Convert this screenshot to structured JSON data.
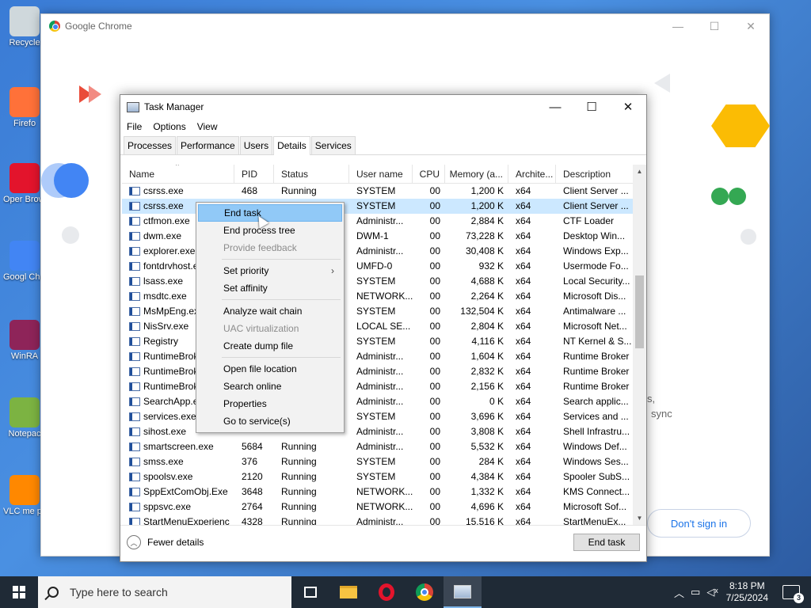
{
  "desktop": {
    "icons": [
      {
        "label": "Recycle",
        "color": "#cfd8dc"
      },
      {
        "label": "Firefo",
        "color": "#ff7139"
      },
      {
        "label": "Oper Brows",
        "color": "#e3142c"
      },
      {
        "label": "Googl Chron",
        "color": "#4285f4"
      },
      {
        "label": "WinRA",
        "color": "#8e2459"
      },
      {
        "label": "Notepac",
        "color": "#7cb342"
      },
      {
        "label": "VLC me playe",
        "color": "#ff8800"
      }
    ]
  },
  "chrome": {
    "title": "Google Chrome",
    "controls": {
      "minimize": "—",
      "maximize": "☐",
      "close": "✕"
    },
    "side_text_1": "s,",
    "side_text_2": "sync",
    "dont_sign_in": "Don't sign in"
  },
  "task_manager": {
    "title": "Task Manager",
    "controls": {
      "minimize": "—",
      "maximize": "☐",
      "close": "✕"
    },
    "menu": [
      "File",
      "Options",
      "View"
    ],
    "tabs": [
      "Processes",
      "Performance",
      "Users",
      "Details",
      "Services"
    ],
    "active_tab": "Details",
    "columns": [
      "Name",
      "PID",
      "Status",
      "User name",
      "CPU",
      "Memory (a...",
      "Archite...",
      "Description"
    ],
    "rows": [
      {
        "name": "csrss.exe",
        "pid": "468",
        "status": "Running",
        "user": "SYSTEM",
        "cpu": "00",
        "mem": "1,200 K",
        "arch": "x64",
        "desc": "Client Server ..."
      },
      {
        "name": "csrss.exe",
        "pid": "",
        "status": "",
        "user": "SYSTEM",
        "cpu": "00",
        "mem": "1,200 K",
        "arch": "x64",
        "desc": "Client Server ...",
        "selected": true
      },
      {
        "name": "ctfmon.exe",
        "pid": "",
        "status": "",
        "user": "Administr...",
        "cpu": "00",
        "mem": "2,884 K",
        "arch": "x64",
        "desc": "CTF Loader"
      },
      {
        "name": "dwm.exe",
        "pid": "",
        "status": "",
        "user": "DWM-1",
        "cpu": "00",
        "mem": "73,228 K",
        "arch": "x64",
        "desc": "Desktop Win..."
      },
      {
        "name": "explorer.exe",
        "pid": "",
        "status": "",
        "user": "Administr...",
        "cpu": "00",
        "mem": "30,408 K",
        "arch": "x64",
        "desc": "Windows Exp..."
      },
      {
        "name": "fontdrvhost.e",
        "pid": "",
        "status": "",
        "user": "UMFD-0",
        "cpu": "00",
        "mem": "932 K",
        "arch": "x64",
        "desc": "Usermode Fo..."
      },
      {
        "name": "lsass.exe",
        "pid": "",
        "status": "",
        "user": "SYSTEM",
        "cpu": "00",
        "mem": "4,688 K",
        "arch": "x64",
        "desc": "Local Security..."
      },
      {
        "name": "msdtc.exe",
        "pid": "",
        "status": "",
        "user": "NETWORK...",
        "cpu": "00",
        "mem": "2,264 K",
        "arch": "x64",
        "desc": "Microsoft Dis..."
      },
      {
        "name": "MsMpEng.exe",
        "pid": "",
        "status": "",
        "user": "SYSTEM",
        "cpu": "00",
        "mem": "132,504 K",
        "arch": "x64",
        "desc": "Antimalware ..."
      },
      {
        "name": "NisSrv.exe",
        "pid": "",
        "status": "",
        "user": "LOCAL SE...",
        "cpu": "00",
        "mem": "2,804 K",
        "arch": "x64",
        "desc": "Microsoft Net..."
      },
      {
        "name": "Registry",
        "pid": "",
        "status": "",
        "user": "SYSTEM",
        "cpu": "00",
        "mem": "4,116 K",
        "arch": "x64",
        "desc": "NT Kernel & S..."
      },
      {
        "name": "RuntimeBroke",
        "pid": "",
        "status": "",
        "user": "Administr...",
        "cpu": "00",
        "mem": "1,604 K",
        "arch": "x64",
        "desc": "Runtime Broker"
      },
      {
        "name": "RuntimeBroke",
        "pid": "",
        "status": "",
        "user": "Administr...",
        "cpu": "00",
        "mem": "2,832 K",
        "arch": "x64",
        "desc": "Runtime Broker"
      },
      {
        "name": "RuntimeBroke",
        "pid": "",
        "status": "",
        "user": "Administr...",
        "cpu": "00",
        "mem": "2,156 K",
        "arch": "x64",
        "desc": "Runtime Broker"
      },
      {
        "name": "SearchApp.ex",
        "pid": "",
        "status": "",
        "user": "Administr...",
        "cpu": "00",
        "mem": "0 K",
        "arch": "x64",
        "desc": "Search applic..."
      },
      {
        "name": "services.exe",
        "pid": "",
        "status": "",
        "user": "SYSTEM",
        "cpu": "00",
        "mem": "3,696 K",
        "arch": "x64",
        "desc": "Services and ..."
      },
      {
        "name": "sihost.exe",
        "pid": "",
        "status": "",
        "user": "Administr...",
        "cpu": "00",
        "mem": "3,808 K",
        "arch": "x64",
        "desc": "Shell Infrastru..."
      },
      {
        "name": "smartscreen.exe",
        "pid": "5684",
        "status": "Running",
        "user": "Administr...",
        "cpu": "00",
        "mem": "5,532 K",
        "arch": "x64",
        "desc": "Windows Def..."
      },
      {
        "name": "smss.exe",
        "pid": "376",
        "status": "Running",
        "user": "SYSTEM",
        "cpu": "00",
        "mem": "284 K",
        "arch": "x64",
        "desc": "Windows Ses..."
      },
      {
        "name": "spoolsv.exe",
        "pid": "2120",
        "status": "Running",
        "user": "SYSTEM",
        "cpu": "00",
        "mem": "4,384 K",
        "arch": "x64",
        "desc": "Spooler SubS..."
      },
      {
        "name": "SppExtComObj.Exe",
        "pid": "3648",
        "status": "Running",
        "user": "NETWORK...",
        "cpu": "00",
        "mem": "1,332 K",
        "arch": "x64",
        "desc": "KMS Connect..."
      },
      {
        "name": "sppsvc.exe",
        "pid": "2764",
        "status": "Running",
        "user": "NETWORK...",
        "cpu": "00",
        "mem": "4,696 K",
        "arch": "x64",
        "desc": "Microsoft Sof..."
      },
      {
        "name": "StartMenuExperienc",
        "pid": "4328",
        "status": "Running",
        "user": "Administr...",
        "cpu": "00",
        "mem": "15,516 K",
        "arch": "x64",
        "desc": "StartMenuEx..."
      }
    ],
    "fewer_details": "Fewer details",
    "end_task_button": "End task"
  },
  "context_menu": {
    "items": [
      {
        "label": "End task",
        "highlighted": true
      },
      {
        "label": "End process tree"
      },
      {
        "label": "Provide feedback",
        "disabled": true
      },
      {
        "separator": true
      },
      {
        "label": "Set priority",
        "submenu": true
      },
      {
        "label": "Set affinity"
      },
      {
        "separator": true
      },
      {
        "label": "Analyze wait chain"
      },
      {
        "label": "UAC virtualization",
        "disabled": true
      },
      {
        "label": "Create dump file"
      },
      {
        "separator": true
      },
      {
        "label": "Open file location"
      },
      {
        "label": "Search online"
      },
      {
        "label": "Properties"
      },
      {
        "label": "Go to service(s)"
      }
    ]
  },
  "taskbar": {
    "search_placeholder": "Type here to search",
    "time": "8:18 PM",
    "date": "7/25/2024",
    "notification_count": "3"
  }
}
